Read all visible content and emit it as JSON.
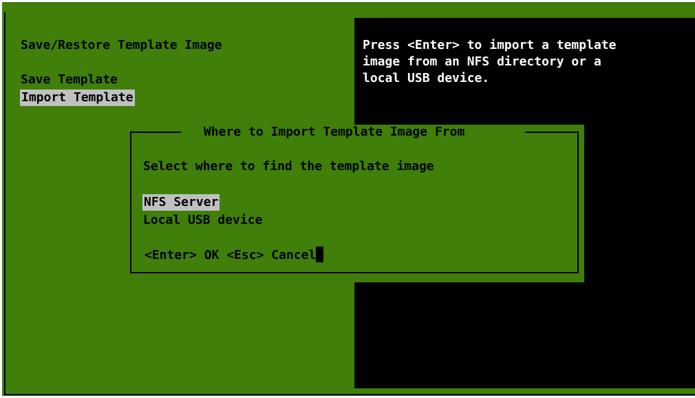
{
  "menu": {
    "title": "Save/Restore Template Image",
    "items": [
      {
        "label": "Save Template"
      },
      {
        "label": "Import Template"
      }
    ]
  },
  "help": {
    "lines": [
      "Press <Enter> to import a template",
      "image from an NFS directory or a",
      "local USB device."
    ]
  },
  "dialog": {
    "title": "Where to Import Template Image From",
    "prompt": "Select where to find the template image",
    "options": [
      {
        "label": "NFS Server"
      },
      {
        "label": "Local USB device"
      }
    ],
    "ok_label": "<Enter> OK",
    "cancel_label": "<Esc> Cancel"
  },
  "colors": {
    "background": "#3f7f0a",
    "help_panel": "#000000",
    "highlight": "#c0c0c0"
  }
}
